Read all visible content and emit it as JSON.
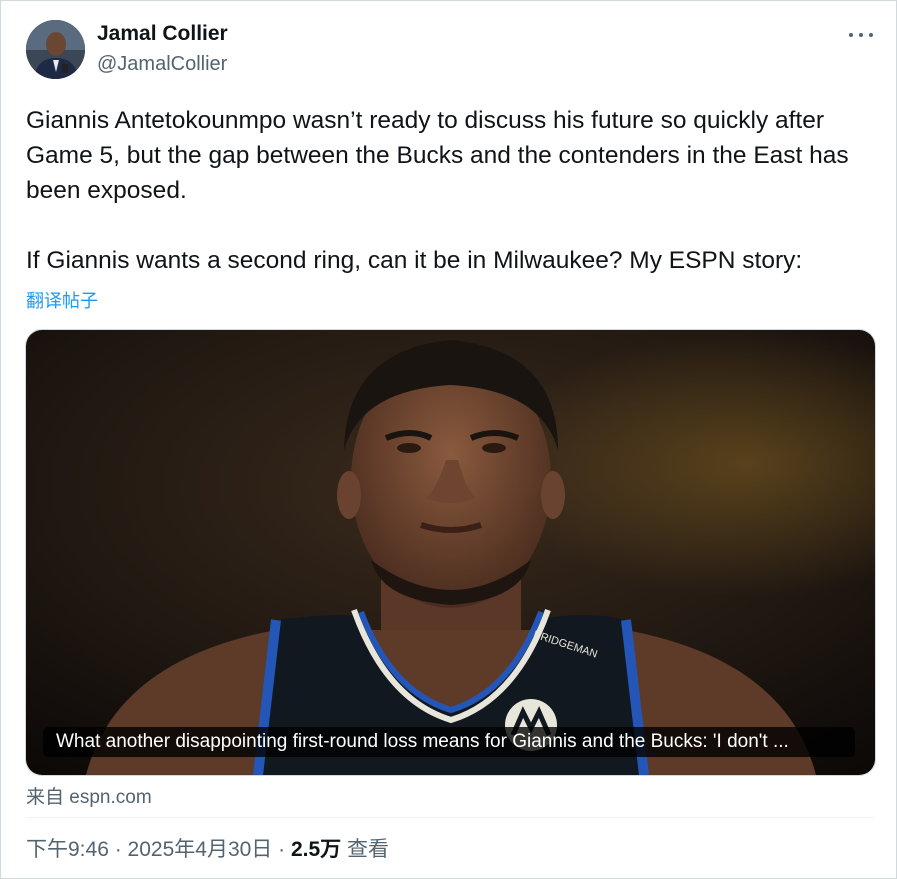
{
  "author": {
    "name": "Jamal Collier",
    "handle": "@JamalCollier"
  },
  "tweet": {
    "paragraph_1": "Giannis Antetokounmpo wasn’t ready to discuss his future so quickly after Game 5, but the gap between the Bucks and the contenders in the East has been exposed.",
    "paragraph_2": "If Giannis wants a second ring, can it be in Milwaukee? My ESPN story:",
    "translate_label": "翻译帖子"
  },
  "card": {
    "caption": "What another disappointing first-round loss means for Giannis and the Bucks: 'I don't ...",
    "jersey_text": "BRIDGEMAN",
    "source": "来自 espn.com"
  },
  "meta": {
    "time": "下午9:46",
    "separator": " · ",
    "date": "2025年4月30日",
    "views_count": "2.5万",
    "views_label": " 查看"
  },
  "colors": {
    "link": "#1d9bf0",
    "secondary_text": "#536471",
    "primary_text": "#0f1419"
  },
  "icons": [
    "more-options-icon"
  ]
}
